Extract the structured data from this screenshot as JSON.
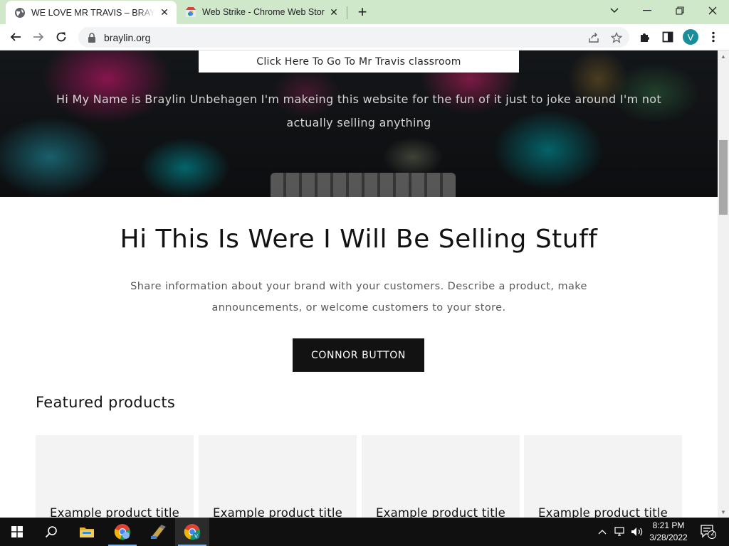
{
  "browser": {
    "tabs": [
      {
        "title": "WE LOVE MR TRAVIS – BRAYLIN.ORG",
        "active": true
      },
      {
        "title": "Web Strike - Chrome Web Store",
        "active": false
      }
    ],
    "url": "braylin.org",
    "profile_initial": "V",
    "accent_color": "#cfe8c9"
  },
  "page": {
    "class_link": "Click Here To Go To Mr Travis classroom",
    "hero_text": "Hi My Name is Braylin Unbehagen I'm makeing this website for the fun of it just to joke around I'm not actually selling anything",
    "headline": "Hi This Is Were I Will Be Selling Stuff",
    "description": "Share information about your brand with your customers. Describe a product, make announcements, or welcome customers to your store.",
    "cta_label": "CONNOR BUTTON",
    "featured_heading": "Featured products",
    "products": [
      {
        "title": "Example product title"
      },
      {
        "title": "Example product title"
      },
      {
        "title": "Example product title"
      },
      {
        "title": "Example product title"
      }
    ]
  },
  "taskbar": {
    "time": "8:21 PM",
    "date": "3/28/2022",
    "notifications": "2",
    "apps": [
      "start-icon",
      "search-icon",
      "file-explorer-icon",
      "chrome-icon",
      "tool-app-icon",
      "chrome-profile-icon"
    ]
  }
}
